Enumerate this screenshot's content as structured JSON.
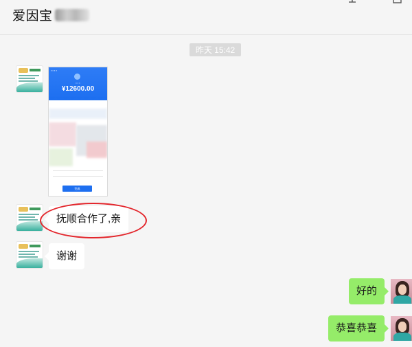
{
  "header": {
    "title": "爱因宝",
    "pin_icon": "pin-icon",
    "window_icon": "square-icon"
  },
  "chat": {
    "timestamp": "昨天 15:42",
    "messages": [
      {
        "sender": "other",
        "type": "image",
        "avatar": "card-avatar"
      },
      {
        "sender": "other",
        "type": "text",
        "text": "抚顺合作了,亲",
        "circled": true
      },
      {
        "sender": "other",
        "type": "text",
        "text": "谢谢"
      },
      {
        "sender": "me",
        "type": "text",
        "text": "好的"
      },
      {
        "sender": "me",
        "type": "text",
        "text": "恭喜恭喜"
      }
    ]
  },
  "payment_screenshot": {
    "amount": "¥12600.00",
    "button_label": "完成"
  },
  "colors": {
    "background": "#f5f5f5",
    "my_bubble": "#95ec69",
    "other_bubble": "#ffffff",
    "annotation": "#e3262c",
    "pay_blue": "#1d6ff0"
  }
}
